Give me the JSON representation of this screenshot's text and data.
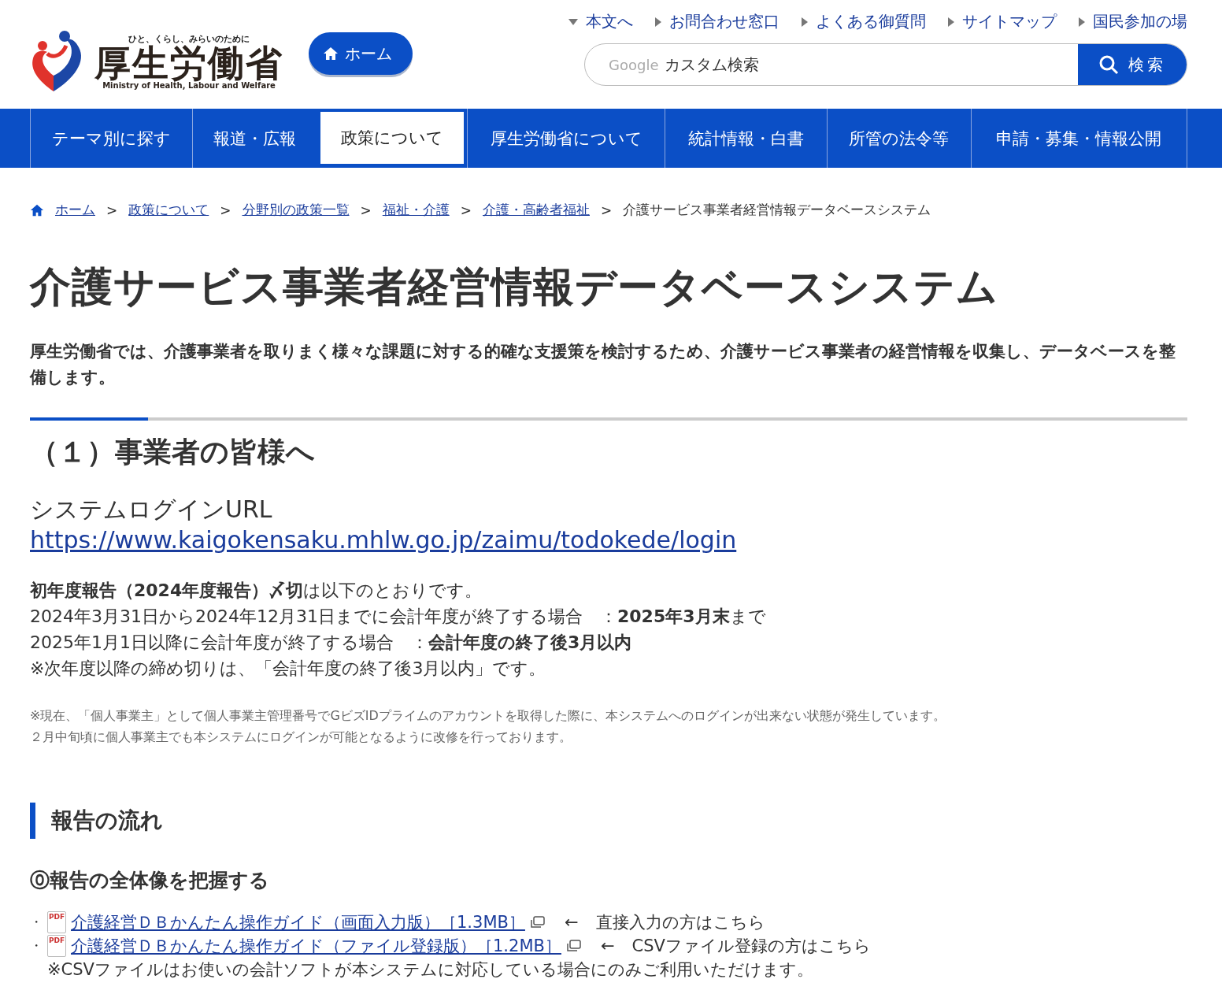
{
  "logo": {
    "tagline": "ひと、くらし、みらいのために",
    "name": "厚生労働省",
    "english": "Ministry of Health, Labour and Welfare"
  },
  "home_button": {
    "label": "ホーム"
  },
  "utility_links": [
    {
      "label": "本文へ",
      "kind": "down"
    },
    {
      "label": "お問合わせ窓口",
      "kind": "right"
    },
    {
      "label": "よくある御質問",
      "kind": "right"
    },
    {
      "label": "サイトマップ",
      "kind": "right"
    },
    {
      "label": "国民参加の場",
      "kind": "right"
    }
  ],
  "search": {
    "brand": "Google",
    "placeholder": "カスタム検索",
    "button": "検索"
  },
  "nav": [
    {
      "label": "テーマ別に探す",
      "selected": false
    },
    {
      "label": "報道・広報",
      "selected": false
    },
    {
      "label": "政策について",
      "selected": true
    },
    {
      "label": "厚生労働省について",
      "selected": false
    },
    {
      "label": "統計情報・白書",
      "selected": false
    },
    {
      "label": "所管の法令等",
      "selected": false
    },
    {
      "label": "申請・募集・情報公開",
      "selected": false
    }
  ],
  "breadcrumb_separator": ">",
  "breadcrumb": [
    {
      "label": "ホーム",
      "link": true
    },
    {
      "label": "政策について",
      "link": true
    },
    {
      "label": "分野別の政策一覧",
      "link": true
    },
    {
      "label": "福祉・介護",
      "link": true
    },
    {
      "label": "介護・高齢者福祉",
      "link": true
    },
    {
      "label": "介護サービス事業者経営情報データベースシステム",
      "link": false
    }
  ],
  "title": "介護サービス事業者経営情報データベースシステム",
  "lead": "厚生労働省では、介護事業者を取りまく様々な課題に対する的確な支援策を検討するため、介護サービス事業者の経営情報を収集し、データベースを整備します。",
  "section": {
    "heading": "（１）事業者の皆様へ",
    "login_label": "システムログインURL",
    "login_url": "https://www.kaigokensaku.mhlw.go.jp/zaimu/todokede/login",
    "deadlines": [
      "**初年度報告（2024年度報告）〆切**は以下のとおりです。",
      "2024年3月31日から2024年12月31日までに会計年度が終了する場合　：**2025年3月末**まで",
      "2025年1月1日以降に会計年度が終了する場合　：**会計年度の終了後3月以内**",
      "※次年度以降の締め切りは、「会計年度の終了後3月以内」です。"
    ],
    "notes": [
      "※現在、「個人事業主」として個人事業主管理番号でGビズIDプライムのアカウントを取得した際に、本システムへのログインが出来ない状態が発生しています。",
      "２月中旬頃に個人事業主でも本システムにログインが可能となるように改修を行っております。"
    ]
  },
  "flow": {
    "heading": "報告の流れ",
    "subheading": "⓪報告の全体像を把握する",
    "documents": [
      {
        "bullet": "・",
        "badge": "PDF",
        "link": "介護経営ＤＢかんたん操作ガイド（画面入力版）［1.3MB］",
        "arrow": "←",
        "note": "直接入力の方はこちら"
      },
      {
        "bullet": "・",
        "badge": "PDF",
        "link": "介護経営ＤＢかんたん操作ガイド（ファイル登録版）［1.2MB］",
        "arrow": "←",
        "note": "CSVファイル登録の方はこちら"
      }
    ],
    "footnote": "※CSVファイルはお使いの会計ソフトが本システムに対応している場合にのみご利用いただけます。"
  }
}
